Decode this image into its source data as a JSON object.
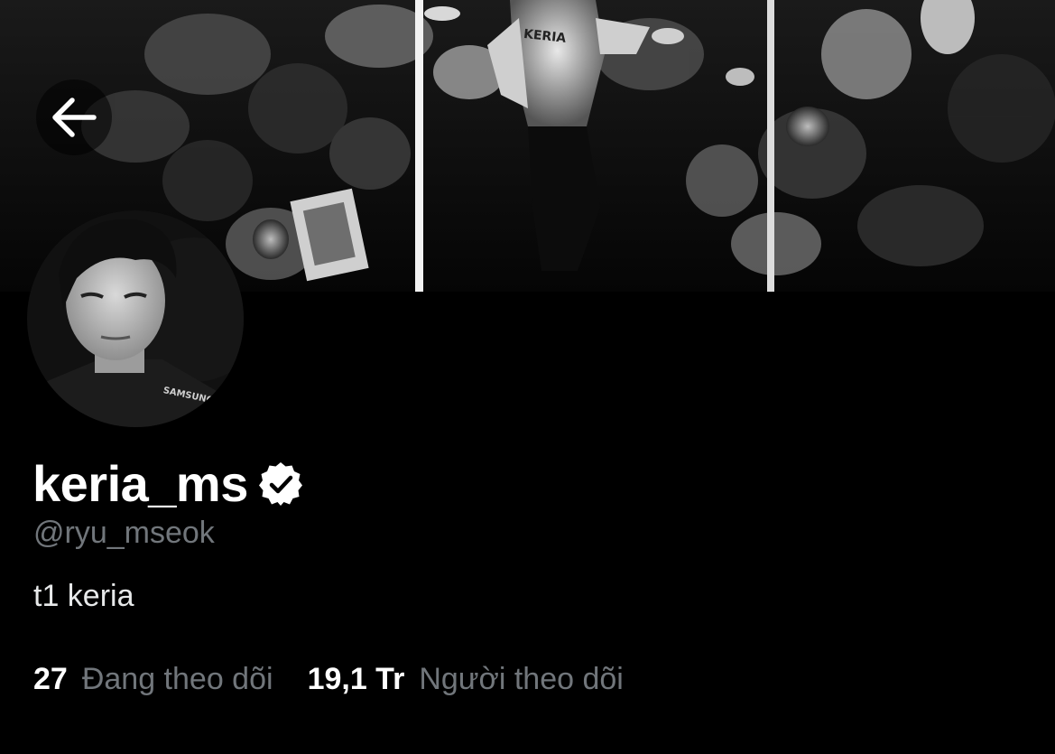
{
  "profile": {
    "display_name": "keria_ms",
    "handle": "@ryu_mseok",
    "bio": "t1 keria",
    "verified": true
  },
  "banner": {
    "jersey_text": "KERIA"
  },
  "stats": {
    "following_count": "27",
    "following_label": "Đang theo dõi",
    "followers_count": "19,1 Tr",
    "followers_label": "Người theo dõi"
  },
  "icons": {
    "back": "arrow-left-icon",
    "verified": "verified-badge-icon"
  },
  "colors": {
    "background": "#000000",
    "text_primary": "#ffffff",
    "text_secondary": "#71767b"
  }
}
